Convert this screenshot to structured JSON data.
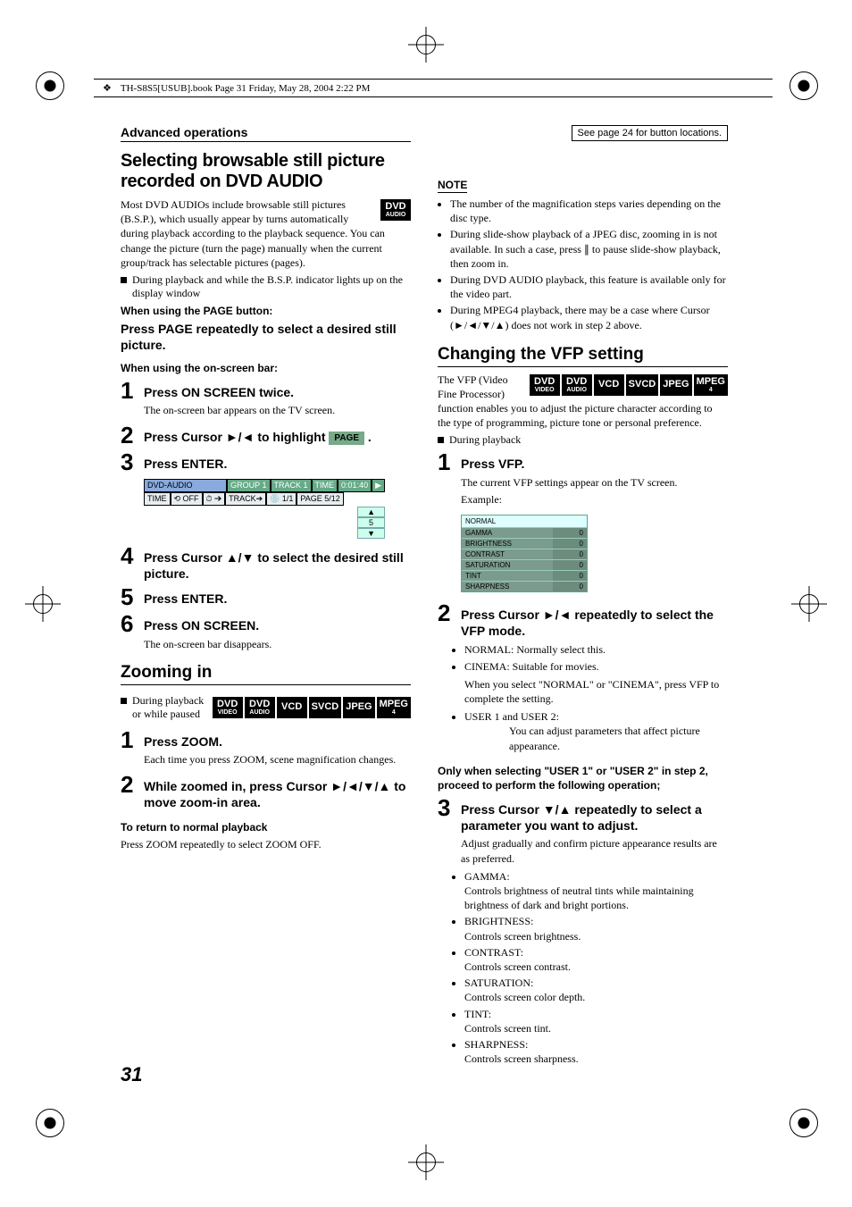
{
  "header": {
    "filename": "TH-S8S5[USUB].book  Page 31  Friday, May 28, 2004  2:22 PM"
  },
  "page_number": "31",
  "top_row": {
    "section": "Advanced operations",
    "ref": "See page 24 for button locations."
  },
  "left": {
    "title1": "Selecting browsable still picture recorded on DVD AUDIO",
    "badge1_top": "DVD",
    "badge1_sub": "AUDIO",
    "para1": "Most DVD AUDIOs include browsable still pictures (B.S.P.), which usually appear by turns automatically during playback according to the playback sequence. You can change the picture (turn the page) manually when the current group/track has selectable pictures (pages).",
    "sq1": "During playback and while the B.S.P. indicator lights up on the display window",
    "when1": "When using the PAGE button:",
    "bold_instr1": "Press PAGE repeatedly to select a desired still picture.",
    "when2": "When using the on-screen bar:",
    "step1": "Press ON SCREEN twice.",
    "step1_sub": "The on-screen bar appears on the TV screen.",
    "step2_pre": "Press Cursor ",
    "step2_post": " to highlight ",
    "step2_arrows": "►/◄",
    "page_chip": "PAGE",
    "step3": "Press ENTER.",
    "osd_r1_a": "DVD-AUDIO",
    "osd_r1_b": "GROUP 1",
    "osd_r1_c": "TRACK 1",
    "osd_r1_d": "TIME",
    "osd_r1_e": "0:01:40",
    "osd_r2_a": "TIME",
    "osd_r2_b": "⟲ OFF",
    "osd_r2_c": "⏱ ➔",
    "osd_r2_d": "TRACK➔",
    "osd_r2_e": "💿 1/1",
    "osd_r2_f": "PAGE 5/12",
    "osd_pager_up": "▲",
    "osd_pager_val": "5",
    "osd_pager_dn": "▼",
    "step4_pre": "Press Cursor ",
    "step4_arrows": "▲/▼",
    "step4_post": " to select the desired still picture.",
    "step5": "Press ENTER.",
    "step6": "Press ON SCREEN.",
    "step6_sub": "The on-screen bar disappears.",
    "title2": "Zooming in",
    "sq2": "During playback or while paused",
    "zbadges": [
      {
        "top": "DVD",
        "sub": "VIDEO"
      },
      {
        "top": "DVD",
        "sub": "AUDIO"
      },
      {
        "top": "VCD",
        "sub": ""
      },
      {
        "top": "SVCD",
        "sub": ""
      },
      {
        "top": "JPEG",
        "sub": ""
      },
      {
        "top": "MPEG",
        "sub": "4"
      }
    ],
    "zstep1": "Press ZOOM.",
    "zstep1_sub": "Each time you press ZOOM, scene magnification changes.",
    "zstep2_pre": "While zoomed in, press Cursor ",
    "zstep2_arrows": "►/◄/▼/▲",
    "zstep2_post": " to move zoom-in area.",
    "ret_title": "To return to normal playback",
    "ret_body": "Press ZOOM repeatedly to select ZOOM OFF."
  },
  "right": {
    "note_label": "NOTE",
    "notes": [
      "The number of the magnification steps varies depending on the disc type.",
      "During slide-show playback of a JPEG disc, zooming in is not available. In such a case, press ∥ to pause slide-show playback, then zoom in.",
      "During DVD AUDIO playback, this feature is available only for the video part.",
      "During MPEG4 playback, there may be a case where Cursor (►/◄/▼/▲) does not work in step 2 above."
    ],
    "title": "Changing the VFP setting",
    "intro": "The VFP (Video Fine Processor) function enables you to adjust the picture character according to the type of programming, picture tone or personal preference.",
    "vbadges": [
      {
        "top": "DVD",
        "sub": "VIDEO"
      },
      {
        "top": "DVD",
        "sub": "AUDIO"
      },
      {
        "top": "VCD",
        "sub": ""
      },
      {
        "top": "SVCD",
        "sub": ""
      },
      {
        "top": "JPEG",
        "sub": ""
      },
      {
        "top": "MPEG",
        "sub": "4"
      }
    ],
    "sq1": "During playback",
    "step1": "Press VFP.",
    "step1_sub": "The current VFP settings appear on the TV screen.",
    "example": "Example:",
    "vfp_header": "NORMAL",
    "vfp_rows": [
      {
        "k": "GAMMA",
        "v": "0"
      },
      {
        "k": "BRIGHTNESS",
        "v": "0"
      },
      {
        "k": "CONTRAST",
        "v": "0"
      },
      {
        "k": "SATURATION",
        "v": "0"
      },
      {
        "k": "TINT",
        "v": "0"
      },
      {
        "k": "SHARPNESS",
        "v": "0"
      }
    ],
    "step2_pre": "Press Cursor ",
    "step2_arrows": "►/◄",
    "step2_post": " repeatedly to select the VFP mode.",
    "modes": {
      "normal_k": "NORMAL:",
      "normal_v": "Normally select this.",
      "cinema_k": "CINEMA:",
      "cinema_v": "Suitable for movies.",
      "line1": "When you select \"NORMAL\" or \"CINEMA\", press VFP to complete the setting.",
      "user_k": "USER 1 and USER 2:",
      "user_v": "You can adjust parameters that affect picture appearance."
    },
    "cond": "Only when selecting \"USER 1\" or \"USER 2\" in step 2, proceed to perform the following operation;",
    "step3_pre": "Press Cursor ",
    "step3_arrows": "▼/▲",
    "step3_post": " repeatedly to select a parameter you want to adjust.",
    "step3_sub": "Adjust gradually and confirm picture appearance results are as preferred.",
    "params": [
      {
        "k": "GAMMA:",
        "v": "Controls brightness of neutral tints while maintaining brightness of dark and bright portions."
      },
      {
        "k": "BRIGHTNESS:",
        "v": "Controls screen brightness."
      },
      {
        "k": "CONTRAST:",
        "v": "Controls screen contrast."
      },
      {
        "k": "SATURATION:",
        "v": "Controls screen color depth."
      },
      {
        "k": "TINT:",
        "v": "Controls screen tint."
      },
      {
        "k": "SHARPNESS:",
        "v": "Controls screen sharpness."
      }
    ]
  }
}
